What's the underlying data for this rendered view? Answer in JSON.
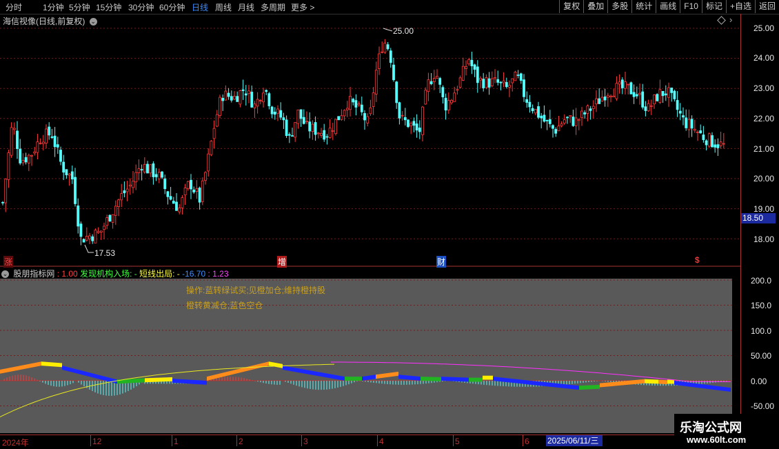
{
  "toolbar": {
    "timeframes": [
      {
        "label": "分时",
        "active": false
      },
      {
        "label": "1分钟",
        "active": false
      },
      {
        "label": "5分钟",
        "active": false
      },
      {
        "label": "15分钟",
        "active": false
      },
      {
        "label": "30分钟",
        "active": false
      },
      {
        "label": "60分钟",
        "active": false
      },
      {
        "label": "日线",
        "active": true
      },
      {
        "label": "周线",
        "active": false
      },
      {
        "label": "月线",
        "active": false
      },
      {
        "label": "多周期",
        "active": false
      },
      {
        "label": "更多 >",
        "active": false
      }
    ],
    "right_buttons": [
      "复权",
      "叠加",
      "多股",
      "统计",
      "画线",
      "F10",
      "标记",
      "+自选",
      "返回"
    ]
  },
  "price_panel": {
    "title": "海信视像(日线,前复权)",
    "y_labels": [
      "25.00",
      "24.00",
      "23.00",
      "22.00",
      "21.00",
      "20.00",
      "19.00",
      "18.00"
    ],
    "current_price": "18.50",
    "high_label": "25.00",
    "low_label": "17.53",
    "markers": [
      {
        "text": "涨",
        "color": "#ff3030",
        "bg": "#a01818"
      },
      {
        "text": "增",
        "color": "#ffffff",
        "bg": "#b02020"
      },
      {
        "text": "财",
        "color": "#ffffff",
        "bg": "#2050c0"
      },
      {
        "text": "$",
        "color": "#ff3030",
        "bg": ""
      }
    ]
  },
  "indicator_panel": {
    "name": "股朋指标网",
    "value_1": ": 1.00",
    "label_2": "发现机构入场: -",
    "label_3": "短线出局: -",
    "value_4": "-16.70",
    "value_5": ": 1.23",
    "note_1": "操作:蓝转绿试买;见橙加仓;维持橙持股",
    "note_2": "橙转黄减仓;蓝色空仓",
    "y_labels": [
      "200.0",
      "150.0",
      "100.0",
      "50.00",
      "0.00",
      "-50.00"
    ]
  },
  "date_axis": {
    "labels": [
      "2024年",
      "12",
      "1",
      "2",
      "3",
      "4",
      "5",
      "6"
    ],
    "cursor_date": "2025/06/11/三"
  },
  "watermark": {
    "line1": "乐淘公式网",
    "line2": "www.60lt.com"
  },
  "colors": {
    "up": "#ff3b3b",
    "down": "#54ffff",
    "panel_bg": "#595959",
    "accent_blue": "#3c8cff"
  }
}
